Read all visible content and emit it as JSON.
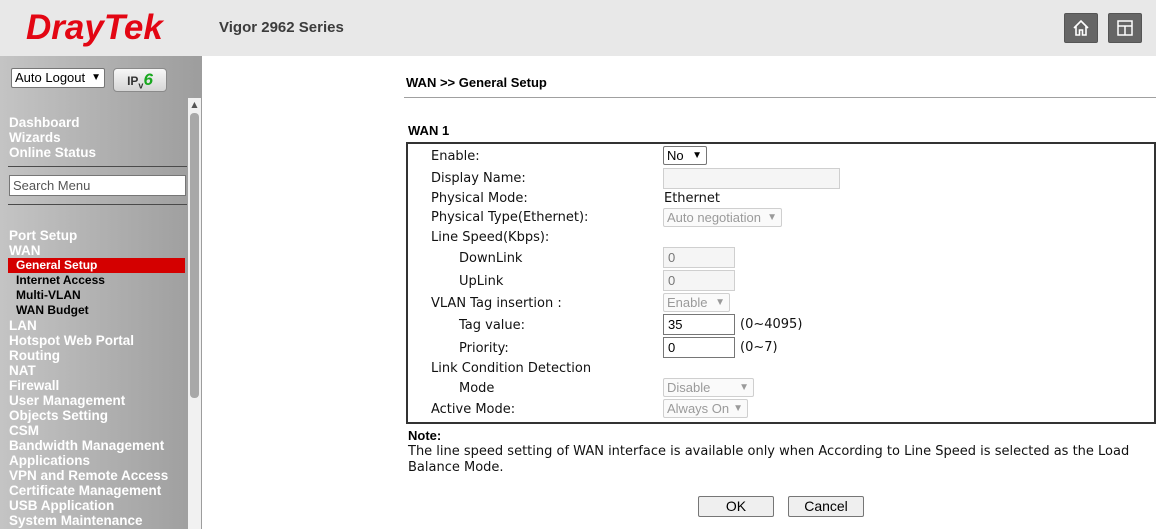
{
  "header": {
    "logo_text": "DrayTek",
    "model": "Vigor 2962 Series",
    "buttons": [
      {
        "icon": "home-icon"
      },
      {
        "icon": "layout-icon"
      }
    ]
  },
  "sidebar": {
    "logout_select_value": "Auto Logout",
    "ipv6_badge": {
      "prefix": "IP",
      "sub": "v",
      "suffix": "6"
    },
    "top_links": [
      "Dashboard",
      "Wizards",
      "Online Status"
    ],
    "search_placeholder": "Search Menu",
    "menu_before": [
      "Port Setup",
      "WAN"
    ],
    "wan_submenu": [
      "General Setup",
      "Internet Access",
      "Multi-VLAN",
      "WAN Budget"
    ],
    "active_item": "General Setup",
    "menu_after": [
      "LAN",
      "Hotspot Web Portal",
      "Routing",
      "NAT",
      "Firewall",
      "User Management",
      "Objects Setting",
      "CSM",
      "Bandwidth Management",
      "Applications",
      "VPN and Remote Access",
      "Certificate Management",
      "USB Application",
      "System Maintenance"
    ]
  },
  "main": {
    "breadcrumb": "WAN >> General Setup",
    "section_title": "WAN 1",
    "form": {
      "enable_label": "Enable:",
      "enable_value": "No",
      "display_name_label": "Display Name:",
      "display_name_value": "",
      "physical_mode_label": "Physical Mode:",
      "physical_mode_value": "Ethernet",
      "physical_type_label": "Physical Type(Ethernet):",
      "physical_type_value": "Auto negotiation",
      "line_speed_label": "Line Speed(Kbps):",
      "downlink_label": "DownLink",
      "downlink_value": "0",
      "uplink_label": "UpLink",
      "uplink_value": "0",
      "vlan_tag_label": "VLAN Tag insertion :",
      "vlan_tag_value": "Enable",
      "tag_value_label": "Tag value:",
      "tag_value": "35",
      "tag_value_range": "(0~4095)",
      "priority_label": "Priority:",
      "priority_value": "0",
      "priority_range": "(0~7)",
      "link_detection_label": "Link Condition Detection",
      "mode_label": "Mode",
      "mode_value": "Disable",
      "active_mode_label": "Active Mode:",
      "active_mode_value": "Always On"
    },
    "note_title": "Note:",
    "note_text": "The line speed setting of WAN interface is available only when According to Line Speed is selected as the Load Balance Mode.",
    "ok_label": "OK",
    "cancel_label": "Cancel"
  }
}
